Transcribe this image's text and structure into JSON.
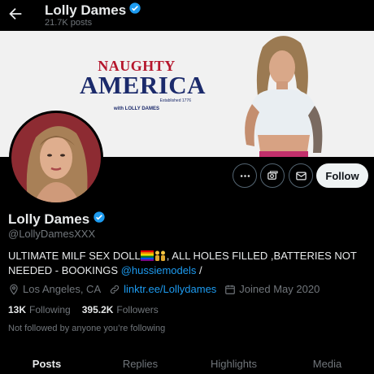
{
  "header": {
    "name": "Lolly Dames",
    "post_count": "21.7K posts"
  },
  "banner": {
    "logo_line1": "NAUGHTY",
    "logo_line2": "AMERICA",
    "logo_tagline": "Established 1776",
    "logo_sub": "with LOLLY DAMES"
  },
  "profile": {
    "display_name": "Lolly Dames",
    "handle": "@LollyDamesXXX",
    "bio_part1": "ULTIMATE MILF SEX DOLL",
    "bio_part2": ", ALL HOLES FILLED ,BATTERIES NOT NEEDED - BOOKINGS ",
    "bio_mention": "@hussiemodels",
    "bio_part3": " /",
    "location": "Los Angeles, CA",
    "website": "linktr.ee/Lollydames",
    "joined": "Joined May 2020",
    "following_count": "13K",
    "following_label": "Following",
    "followers_count": "395.2K",
    "followers_label": "Followers",
    "not_followed_text": "Not followed by anyone you’re following"
  },
  "actions": {
    "follow_label": "Follow"
  },
  "tabs": [
    {
      "label": "Posts",
      "active": true
    },
    {
      "label": "Replies",
      "active": false
    },
    {
      "label": "Highlights",
      "active": false
    },
    {
      "label": "Media",
      "active": false
    }
  ],
  "colors": {
    "accent": "#1d9bf0",
    "background": "#000000",
    "text_primary": "#e7e9ea",
    "text_secondary": "#71767b",
    "follow_button_bg": "#eff3f4"
  }
}
